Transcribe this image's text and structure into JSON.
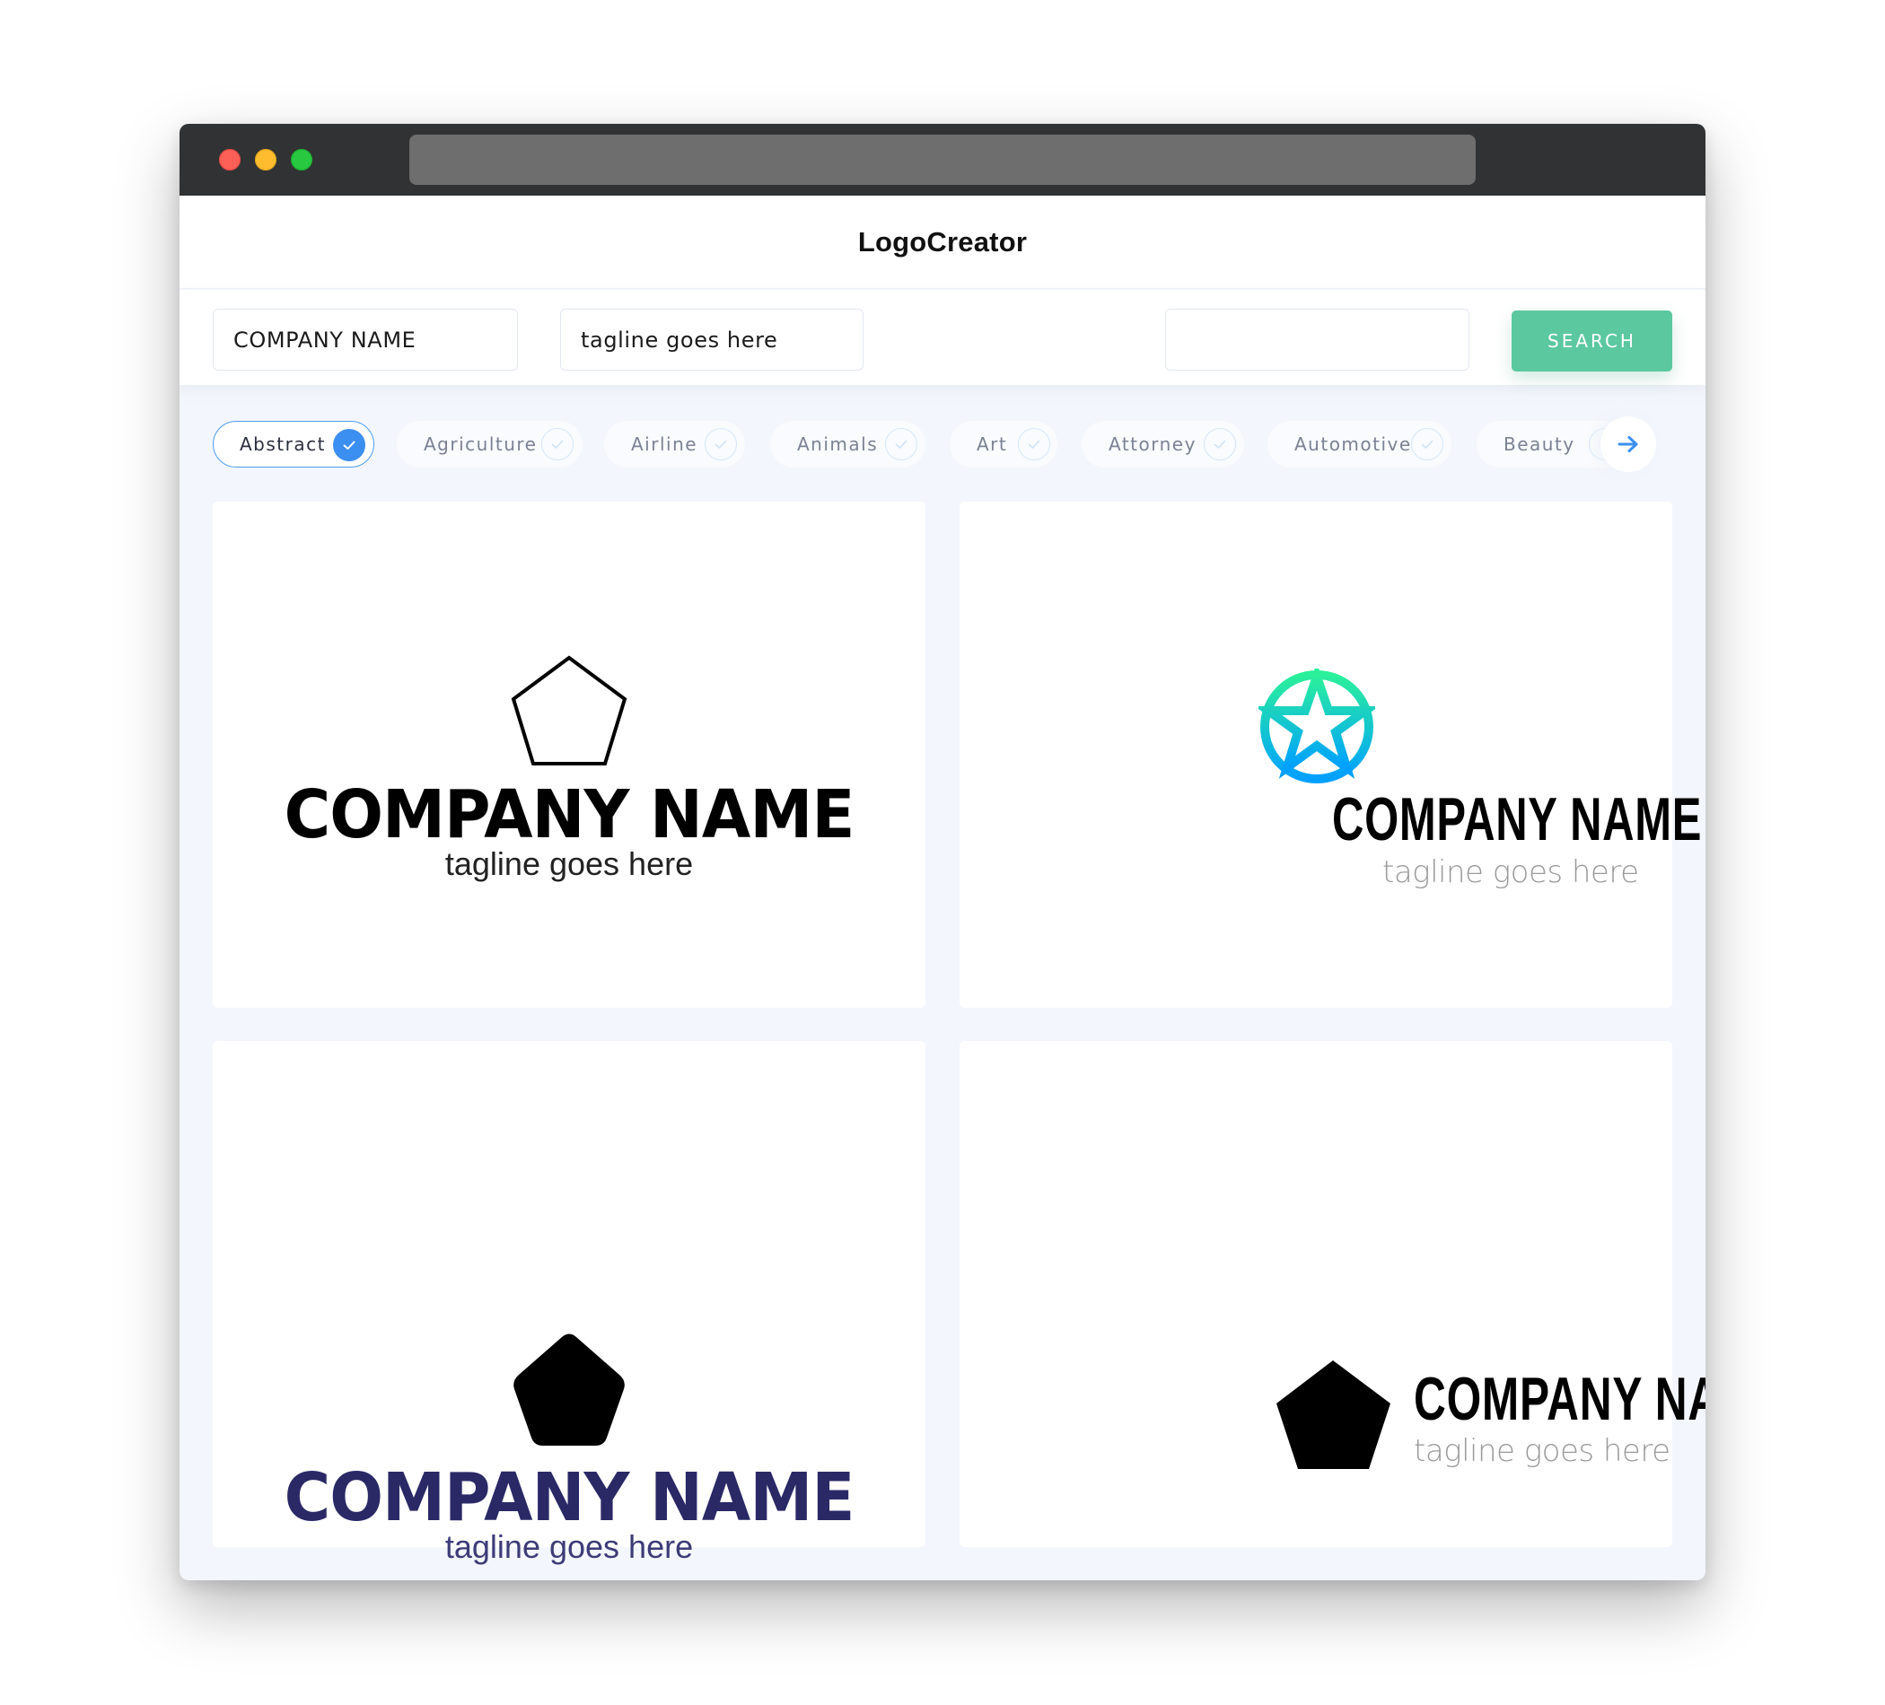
{
  "browser": {
    "traffic_lights": [
      "close",
      "minimize",
      "maximize"
    ],
    "url": ""
  },
  "header": {
    "brand": "LogoCreator"
  },
  "search": {
    "company_value": "COMPANY NAME",
    "tagline_value": "tagline goes here",
    "keyword_value": "",
    "button_label": "SEARCH",
    "button_color": "#5BC8A0"
  },
  "categories": {
    "items": [
      {
        "label": "Abstract",
        "selected": true
      },
      {
        "label": "Agriculture",
        "selected": false
      },
      {
        "label": "Airline",
        "selected": false
      },
      {
        "label": "Animals",
        "selected": false
      },
      {
        "label": "Art",
        "selected": false
      },
      {
        "label": "Attorney",
        "selected": false
      },
      {
        "label": "Automotive",
        "selected": false
      },
      {
        "label": "Beauty",
        "selected": false
      }
    ],
    "next_icon": "arrow-right-icon",
    "accent_color": "#3B8FF0"
  },
  "logos": [
    {
      "icon": "pentagon-outline-icon",
      "company": "COMPANY NAME",
      "tagline": "tagline goes here",
      "company_color": "#000000",
      "tagline_color": "#222222",
      "layout": "stacked"
    },
    {
      "icon": "star-in-circle-icon",
      "company": "COMPANY NAME",
      "tagline": "tagline goes here",
      "company_color": "#000000",
      "tagline_color": "#9A9A9A",
      "icon_gradient": [
        "#2BF09A",
        "#00A0FF"
      ],
      "layout": "stacked"
    },
    {
      "icon": "pentagon-rounded-filled-icon",
      "company": "COMPANY NAME",
      "tagline": "tagline goes here",
      "company_color": "#2A2966",
      "tagline_color": "#3D3C78",
      "layout": "stacked"
    },
    {
      "icon": "pentagon-filled-icon",
      "company": "COMPANY NAME",
      "tagline": "tagline goes here",
      "company_color": "#000000",
      "tagline_color": "#9A9A9A",
      "layout": "inline"
    }
  ]
}
